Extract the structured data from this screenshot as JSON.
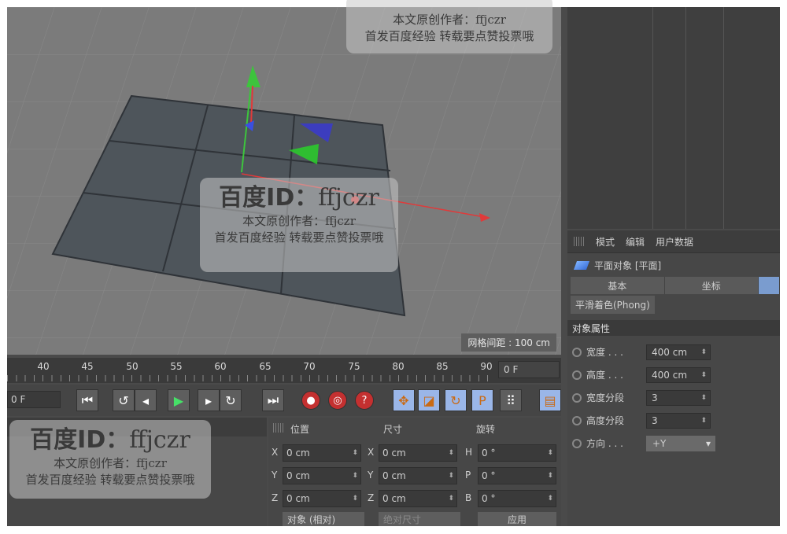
{
  "viewport": {
    "grid_spacing": "网格间距 : 100 cm"
  },
  "attributes": {
    "menu": [
      "模式",
      "编辑",
      "用户数据"
    ],
    "title": "平面对象 [平面]",
    "tabs": [
      "基本",
      "坐标"
    ],
    "phong": "平滑着色(Phong)",
    "section": "对象属性",
    "props": [
      {
        "label": "宽度 . . .",
        "value": "400 cm"
      },
      {
        "label": "高度 . . .",
        "value": "400 cm"
      },
      {
        "label": "宽度分段",
        "value": "3"
      },
      {
        "label": "高度分段",
        "value": "3"
      },
      {
        "label": "方向 . . .",
        "value": "+Y"
      }
    ]
  },
  "timeline": {
    "ticks": [
      "40",
      "45",
      "50",
      "55",
      "60",
      "65",
      "70",
      "75",
      "80",
      "85",
      "90"
    ],
    "end_frame": "0 F",
    "start_frame": "0 F"
  },
  "transport": {
    "buttons": [
      "first-frame",
      "prev-key",
      "prev-frame",
      "play",
      "next-frame",
      "next-key",
      "last-frame",
      "record",
      "autokey",
      "keyframe-help",
      "move-key",
      "scale-key",
      "rotate-key",
      "param-key",
      "pla-key",
      "film"
    ]
  },
  "coordinates": {
    "headers": [
      "位置",
      "尺寸",
      "旋转"
    ],
    "rows": [
      {
        "a1": "X",
        "v1": "0 cm",
        "a2": "X",
        "v2": "0 cm",
        "a3": "H",
        "v3": "0 °"
      },
      {
        "a1": "Y",
        "v1": "0 cm",
        "a2": "Y",
        "v2": "0 cm",
        "a3": "P",
        "v3": "0 °"
      },
      {
        "a1": "Z",
        "v1": "0 cm",
        "a2": "Z",
        "v2": "0 cm",
        "a3": "B",
        "v3": "0 °"
      }
    ],
    "mode_select": "对象 (相对)",
    "size_select": "绝对尺寸",
    "apply": "应用"
  },
  "watermark": {
    "line1_a": "百度ID：",
    "line1_b": "ffjczr",
    "line2": "本文原创作者：ffjczr",
    "line3": "首发百度经验  转载要点赞投票哦"
  }
}
